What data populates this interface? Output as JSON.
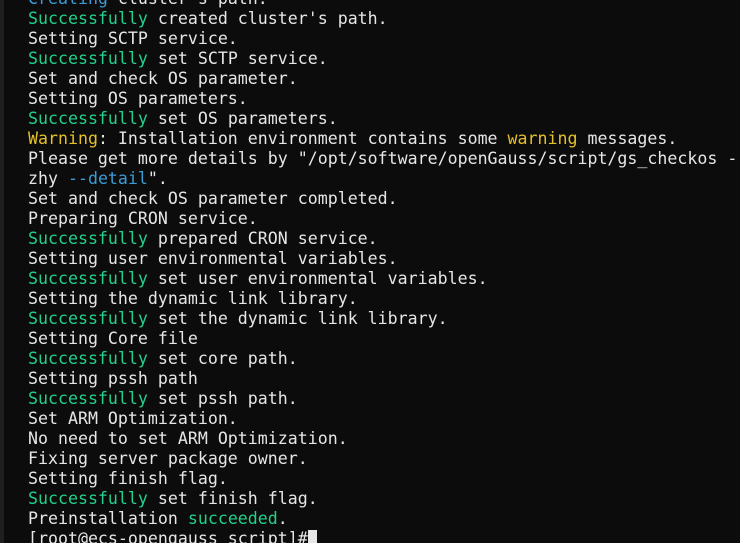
{
  "terminal": {
    "lines": [
      [
        {
          "text": "Creating",
          "color": "cyan"
        },
        {
          "text": " cluster's path."
        }
      ],
      [
        {
          "text": "Successfully",
          "color": "green"
        },
        {
          "text": " created cluster's path."
        }
      ],
      [
        {
          "text": "Setting SCTP service."
        }
      ],
      [
        {
          "text": "Successfully",
          "color": "green"
        },
        {
          "text": " set SCTP service."
        }
      ],
      [
        {
          "text": "Set and check OS parameter."
        }
      ],
      [
        {
          "text": "Setting OS parameters."
        }
      ],
      [
        {
          "text": "Successfully",
          "color": "green"
        },
        {
          "text": " set OS parameters."
        }
      ],
      [
        {
          "text": "Warning",
          "color": "yellow"
        },
        {
          "text": ": Installation environment contains some "
        },
        {
          "text": "warning",
          "color": "yellow"
        },
        {
          "text": " messages."
        }
      ],
      [
        {
          "text": "Please get more details by \"/opt/software/openGauss/script/gs_checkos -"
        }
      ],
      [
        {
          "text": "zhy "
        },
        {
          "text": "--detail",
          "color": "cyan"
        },
        {
          "text": "\"."
        }
      ],
      [
        {
          "text": "Set and check OS parameter completed."
        }
      ],
      [
        {
          "text": "Preparing CRON service."
        }
      ],
      [
        {
          "text": "Successfully",
          "color": "green"
        },
        {
          "text": " prepared CRON service."
        }
      ],
      [
        {
          "text": "Setting user environmental variables."
        }
      ],
      [
        {
          "text": "Successfully",
          "color": "green"
        },
        {
          "text": " set user environmental variables."
        }
      ],
      [
        {
          "text": "Setting the dynamic link library."
        }
      ],
      [
        {
          "text": "Successfully",
          "color": "green"
        },
        {
          "text": " set the dynamic link library."
        }
      ],
      [
        {
          "text": "Setting Core file"
        }
      ],
      [
        {
          "text": "Successfully",
          "color": "green"
        },
        {
          "text": " set core path."
        }
      ],
      [
        {
          "text": "Setting pssh path"
        }
      ],
      [
        {
          "text": "Successfully",
          "color": "green"
        },
        {
          "text": " set pssh path."
        }
      ],
      [
        {
          "text": "Set ARM Optimization."
        }
      ],
      [
        {
          "text": "No need to set ARM Optimization."
        }
      ],
      [
        {
          "text": "Fixing server package owner."
        }
      ],
      [
        {
          "text": "Setting finish flag."
        }
      ],
      [
        {
          "text": "Successfully",
          "color": "green"
        },
        {
          "text": " set finish flag."
        }
      ],
      [
        {
          "text": "Preinstallation "
        },
        {
          "text": "succeeded",
          "color": "green"
        },
        {
          "text": "."
        }
      ]
    ],
    "prompt": "[root@ecs-opengauss script]#"
  },
  "colors": {
    "background": "#0c0c0c",
    "default": "#e6e6e6",
    "green": "#23d18b",
    "yellow": "#e5c02a",
    "cyan": "#3b9bd6"
  }
}
